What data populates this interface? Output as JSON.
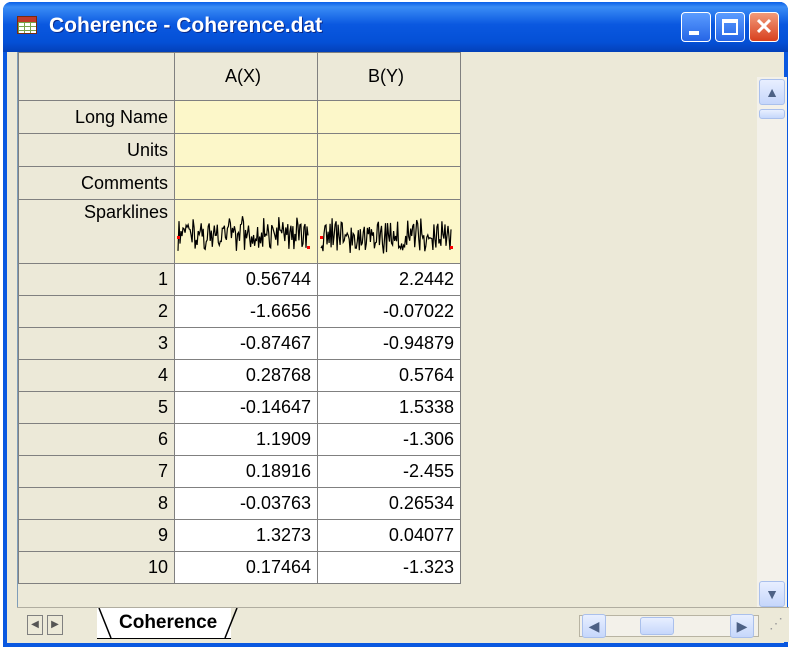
{
  "window": {
    "title": "Coherence - Coherence.dat"
  },
  "columns": [
    {
      "header": "A(X)",
      "long_name": "",
      "units": "",
      "comments": ""
    },
    {
      "header": "B(Y)",
      "long_name": "",
      "units": "",
      "comments": ""
    }
  ],
  "row_labels": {
    "long_name": "Long Name",
    "units": "Units",
    "comments": "Comments",
    "sparklines": "Sparklines"
  },
  "rows": [
    {
      "index": "1",
      "a": "0.56744",
      "b": "2.2442"
    },
    {
      "index": "2",
      "a": "-1.6656",
      "b": "-0.07022"
    },
    {
      "index": "3",
      "a": "-0.87467",
      "b": "-0.94879"
    },
    {
      "index": "4",
      "a": "0.28768",
      "b": "0.5764"
    },
    {
      "index": "5",
      "a": "-0.14647",
      "b": "1.5338"
    },
    {
      "index": "6",
      "a": "1.1909",
      "b": "-1.306"
    },
    {
      "index": "7",
      "a": "0.18916",
      "b": "-2.455"
    },
    {
      "index": "8",
      "a": "-0.03763",
      "b": "0.26534"
    },
    {
      "index": "9",
      "a": "1.3273",
      "b": "0.04077"
    },
    {
      "index": "10",
      "a": "0.17464",
      "b": "-1.323"
    }
  ],
  "sheet_tab": {
    "label": "Coherence"
  },
  "colors": {
    "title_bar": "#0a58e0",
    "meta_row_bg": "#fcf7c9",
    "sparkline": "#000000",
    "sparkline_marker": "#ff0000"
  },
  "icons": {
    "app": "worksheet-icon",
    "minimize": "minimize-icon",
    "maximize": "maximize-icon",
    "close": "close-icon"
  }
}
